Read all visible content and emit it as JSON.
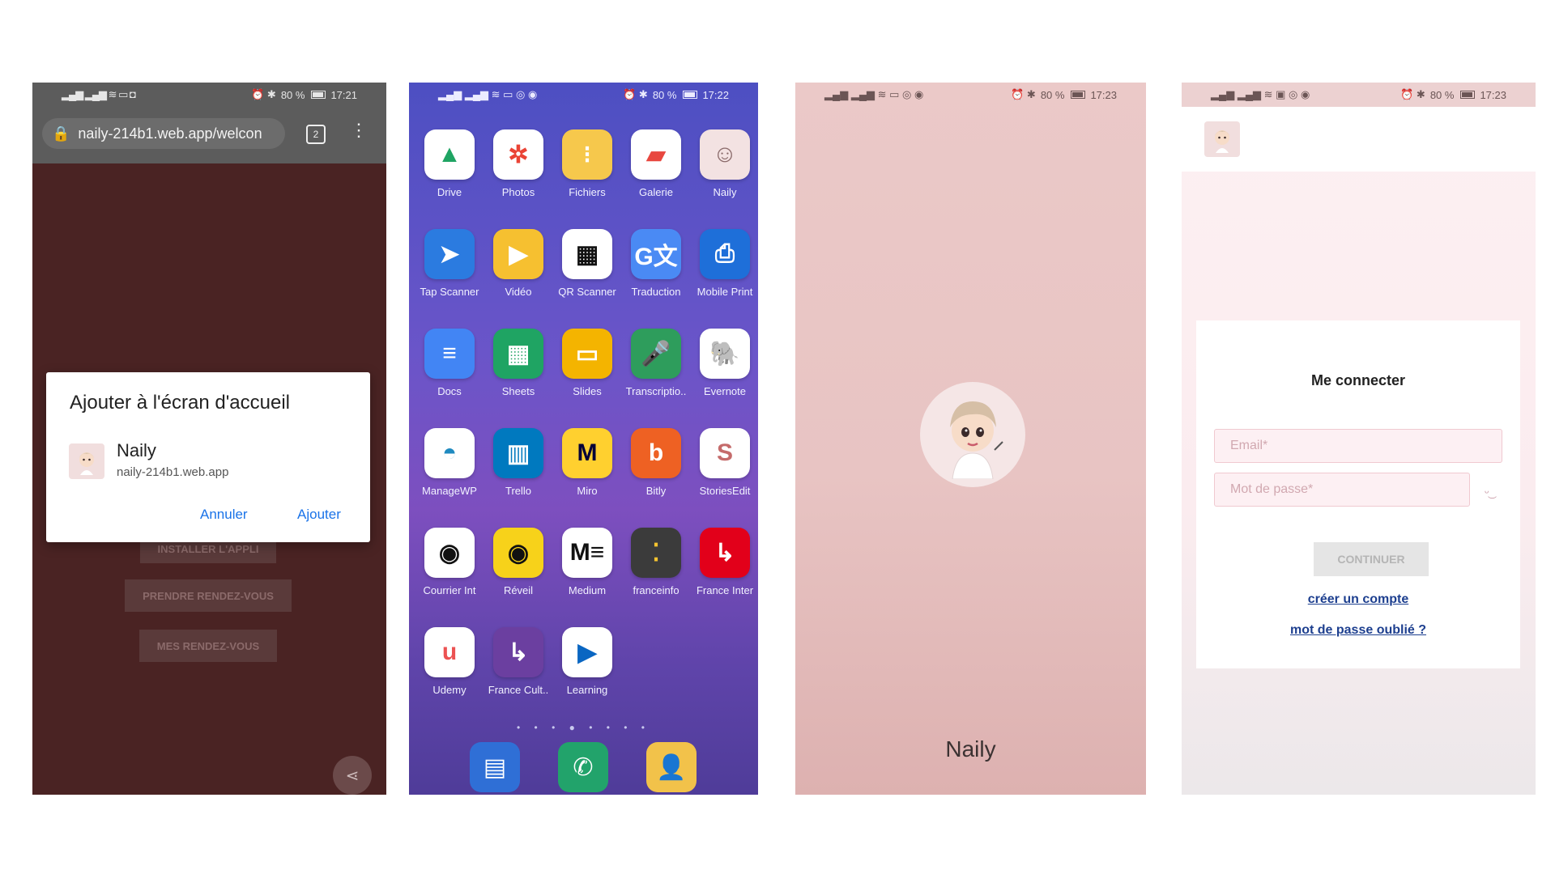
{
  "phone1": {
    "status": {
      "time": "17:21",
      "battery": "80 %"
    },
    "browser": {
      "url": "naily-214b1.web.app/welcon",
      "tab_count": "2"
    },
    "page_buttons": [
      "INSTALLER L'APPLI",
      "PRENDRE RENDEZ-VOUS",
      "MES RENDEZ-VOUS"
    ],
    "dialog": {
      "title": "Ajouter à l'écran d'accueil",
      "app_name": "Naily",
      "app_url": "naily-214b1.web.app",
      "cancel": "Annuler",
      "add": "Ajouter"
    }
  },
  "phone2": {
    "status": {
      "time": "17:22",
      "battery": "80 %"
    },
    "apps": [
      {
        "label": "Drive",
        "icon": "drive-icon",
        "glyph": "▲",
        "bg": "#ffffff",
        "fg": "#1fa463"
      },
      {
        "label": "Photos",
        "icon": "photos-icon",
        "glyph": "✲",
        "bg": "#ffffff",
        "fg": "#ea4335"
      },
      {
        "label": "Fichiers",
        "icon": "files-icon",
        "glyph": "⁝",
        "bg": "#f6c84c",
        "fg": "#ffffff"
      },
      {
        "label": "Galerie",
        "icon": "gallery-icon",
        "glyph": "▰",
        "bg": "#ffffff",
        "fg": "#e8473f"
      },
      {
        "label": "Naily",
        "icon": "naily-app-icon",
        "glyph": "☺",
        "bg": "#f3e2e2",
        "fg": "#8a6a6a"
      },
      {
        "label": "Tap Scanner",
        "icon": "tap-scanner-icon",
        "glyph": "➤",
        "bg": "#2b7be0",
        "fg": "#ffffff"
      },
      {
        "label": "Vidéo",
        "icon": "video-icon",
        "glyph": "▶",
        "bg": "#f6c030",
        "fg": "#ffffff"
      },
      {
        "label": "QR Scanner",
        "icon": "qr-scanner-icon",
        "glyph": "▦",
        "bg": "#ffffff",
        "fg": "#111111"
      },
      {
        "label": "Traduction",
        "icon": "translate-icon",
        "glyph": "G文",
        "bg": "#4a8af4",
        "fg": "#ffffff"
      },
      {
        "label": "Mobile Print",
        "icon": "mobile-print-icon",
        "glyph": "⎙",
        "bg": "#1e6fd9",
        "fg": "#ffffff"
      },
      {
        "label": "Docs",
        "icon": "docs-icon",
        "glyph": "≡",
        "bg": "#4285f4",
        "fg": "#ffffff"
      },
      {
        "label": "Sheets",
        "icon": "sheets-icon",
        "glyph": "▦",
        "bg": "#1fa463",
        "fg": "#ffffff"
      },
      {
        "label": "Slides",
        "icon": "slides-icon",
        "glyph": "▭",
        "bg": "#f4b400",
        "fg": "#ffffff"
      },
      {
        "label": "Transcriptio..",
        "icon": "transcription-icon",
        "glyph": "🎤",
        "bg": "#2e9d5c",
        "fg": "#ffffff"
      },
      {
        "label": "Evernote",
        "icon": "evernote-icon",
        "glyph": "🐘",
        "bg": "#ffffff",
        "fg": "#2dbe60"
      },
      {
        "label": "ManageWP",
        "icon": "managewp-icon",
        "glyph": "◓",
        "bg": "#ffffff",
        "fg": "#1f8ac0"
      },
      {
        "label": "Trello",
        "icon": "trello-icon",
        "glyph": "▥",
        "bg": "#0079bf",
        "fg": "#ffffff"
      },
      {
        "label": "Miro",
        "icon": "miro-icon",
        "glyph": "M",
        "bg": "#ffd02f",
        "fg": "#050038"
      },
      {
        "label": "Bitly",
        "icon": "bitly-icon",
        "glyph": "b",
        "bg": "#ee6123",
        "fg": "#ffffff"
      },
      {
        "label": "StoriesEdit",
        "icon": "storiesedit-icon",
        "glyph": "S",
        "bg": "#ffffff",
        "fg": "#c56b6b"
      },
      {
        "label": "Courrier Int",
        "icon": "courrier-int-icon",
        "glyph": "◉",
        "bg": "#ffffff",
        "fg": "#111111"
      },
      {
        "label": "Réveil",
        "icon": "reveil-icon",
        "glyph": "◉",
        "bg": "#f7d21a",
        "fg": "#111111"
      },
      {
        "label": "Medium",
        "icon": "medium-icon",
        "glyph": "M≡",
        "bg": "#ffffff",
        "fg": "#111111"
      },
      {
        "label": "franceinfo",
        "icon": "franceinfo-icon",
        "glyph": "⁚",
        "bg": "#3b3b3b",
        "fg": "#f6c430"
      },
      {
        "label": "France Inter",
        "icon": "france-inter-icon",
        "glyph": "↳",
        "bg": "#e2001a",
        "fg": "#ffffff"
      },
      {
        "label": "Udemy",
        "icon": "udemy-icon",
        "glyph": "u",
        "bg": "#ffffff",
        "fg": "#ec5252"
      },
      {
        "label": "France Cult..",
        "icon": "france-culture-icon",
        "glyph": "↳",
        "bg": "#6b3fa0",
        "fg": "#ffffff"
      },
      {
        "label": "Learning",
        "icon": "learning-icon",
        "glyph": "▶",
        "bg": "#ffffff",
        "fg": "#0a66c2"
      }
    ],
    "page_dots": "• • • ● • • • •",
    "dock": [
      {
        "icon": "messages-icon",
        "glyph": "▤",
        "bg": "#2f6fd6",
        "fg": "#ffffff"
      },
      {
        "icon": "phone-icon",
        "glyph": "✆",
        "bg": "#22a36b",
        "fg": "#ffffff"
      },
      {
        "icon": "contacts-icon",
        "glyph": "👤",
        "bg": "#f2c24a",
        "fg": "#ffffff"
      }
    ]
  },
  "phone3": {
    "status": {
      "time": "17:23",
      "battery": "80 %"
    },
    "splash_name": "Naily"
  },
  "phone4": {
    "status": {
      "time": "17:23",
      "battery": "80 %"
    },
    "login": {
      "title": "Me connecter",
      "email_placeholder": "Email*",
      "password_placeholder": "Mot de passe*",
      "continue": "CONTINUER",
      "create_account": "créer un compte",
      "forgot_password": "mot de passe oublié ?"
    }
  }
}
